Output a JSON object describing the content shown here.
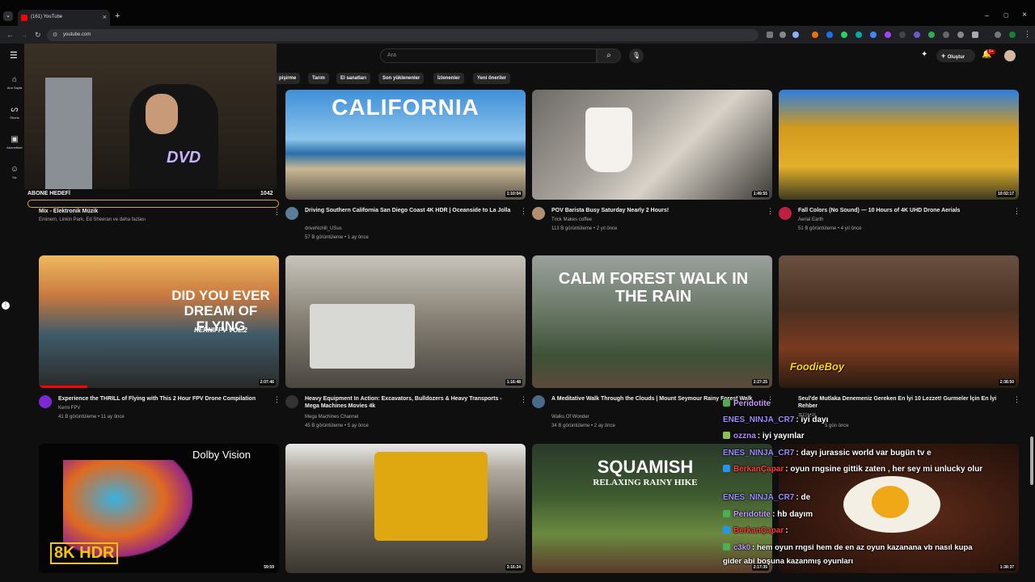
{
  "browser": {
    "tab_title": "(161) YouTube",
    "url": "youtube.com"
  },
  "header": {
    "search_placeholder": "Ara",
    "create_label": "Oluştur",
    "notif_count": "9+"
  },
  "sidebar": {
    "items": [
      {
        "label": "Ana Sayfa",
        "icon": "home-icon"
      },
      {
        "label": "Shorts",
        "icon": "shorts-icon"
      },
      {
        "label": "Abonelikler",
        "icon": "subscriptions-icon"
      },
      {
        "label": "Siz",
        "icon": "you-icon"
      }
    ]
  },
  "chips": [
    "pişirme",
    "Tarım",
    "El sanatları",
    "Son yüklenenler",
    "İzlenenler",
    "Yeni öneriler"
  ],
  "overlay": {
    "goal_label": "ABONE HEDEFİ",
    "goal_count": "1042"
  },
  "videos": [
    {
      "title": "Mix - Elektronik Müzik",
      "channel": "Eminem, Linkin Park, Ed Sheeran ve daha fazlası",
      "stats": "",
      "duration": ""
    },
    {
      "title": "Driving Southern California San Diego Coast 4K HDR | Oceanside to La Jolla",
      "channel": "driveNchill_USus",
      "stats": "57 B görüntüleme • 1 ay önce",
      "duration": "1:10:04",
      "overlay": "CALIFORNIA"
    },
    {
      "title": "POV Barista Busy Saturday Nearly 2 Hours!",
      "channel": "Trick Makes coffee",
      "stats": "113 B görüntüleme • 2 yıl önce",
      "duration": "1:49:55"
    },
    {
      "title": "Fall Colors (No Sound) — 10 Hours of 4K UHD Drone Aerials",
      "channel": "Aerial Earth",
      "stats": "51 B görüntüleme • 4 yıl önce",
      "duration": "10:02:17"
    },
    {
      "title": "Experience the THRILL of Flying with This 2 Hour FPV Drone Compilation",
      "channel": "Kerni FPV",
      "stats": "41 B görüntüleme • 11 ay önce",
      "duration": "2:07:46",
      "overlay": "DID YOU EVER DREAM OF FLYING",
      "overlay2": "KERNIFPV VOL.2"
    },
    {
      "title": "Heavy Equipment In Action: Excavators, Bulldozers & Heavy Transports - Mega Machines Movies 4k",
      "channel": "Mega Machines Channel",
      "stats": "45 B görüntüleme • 5 ay önce",
      "duration": "1:16:48"
    },
    {
      "title": "A Meditative Walk Through the Clouds | Mount Seymour Rainy Forest Walk",
      "channel": "Walks Of Wonder",
      "stats": "34 B görüntüleme • 2 ay önce",
      "duration": "2:27:25",
      "overlay": "CALM FOREST WALK IN THE RAIN"
    },
    {
      "title": "Seul'de Mutlaka Denemeniz Gereken En İyi 10 Lezzet! Gurmeler İçin En İyi Rehber",
      "channel": "푸디보이",
      "stats": "5 gün önce",
      "duration": "2:38:50",
      "overlay": "FoodieBoy"
    },
    {
      "title": "",
      "channel": "",
      "stats": "",
      "duration": "59:59",
      "overlay": "8K HDR",
      "overlay2": "Dolby Vision"
    },
    {
      "title": "",
      "channel": "",
      "stats": "",
      "duration": "3:16:24"
    },
    {
      "title": "",
      "channel": "",
      "stats": "",
      "duration": "2:17:35",
      "overlay": "SQUAMISH",
      "overlay2": "RELAXING RAINY HIKE"
    },
    {
      "title": "",
      "channel": "",
      "stats": "",
      "duration": "1:38:37"
    }
  ],
  "chat": [
    {
      "nick": "Peridotite",
      "msg": "",
      "color": "#c89cff",
      "badge": "#4caf50"
    },
    {
      "nick": "ENES_NINJA_CR7",
      "msg": ": iyi dayı",
      "color": "#9b8cff",
      "badge": ""
    },
    {
      "nick": "ozzna",
      "msg": ": iyi yayınlar",
      "color": "#b388ff",
      "badge": "#8bc34a"
    },
    {
      "nick": "ENES_NINJA_CR7",
      "msg": ": dayı jurassic world var bugün tv e",
      "color": "#9b8cff",
      "badge": ""
    },
    {
      "nick": "BerkanÇapar",
      "msg": ": oyun rngsine gittik zaten , her sey mi unlucky olur",
      "color": "#ff3b3b",
      "badge": "#2196f3"
    },
    {
      "nick": "ENES_NINJA_CR7",
      "msg": ": de",
      "color": "#9b8cff",
      "badge": ""
    },
    {
      "nick": "Peridotite",
      "msg": ": hb dayım",
      "color": "#c89cff",
      "badge": "#4caf50"
    },
    {
      "nick": "BerkanÇapar",
      "msg": ":",
      "color": "#ff3b3b",
      "badge": "#2196f3"
    },
    {
      "nick": "c3k0",
      "msg": ": hem oyun rngsi hem de en az oyun kazanana vb nasıl kupa",
      "color": "#c89cff",
      "badge": "#4caf50"
    },
    {
      "nick": "",
      "msg": "gider abi boşuna kazanmış oyunları",
      "color": "#ffffff",
      "badge": ""
    }
  ]
}
